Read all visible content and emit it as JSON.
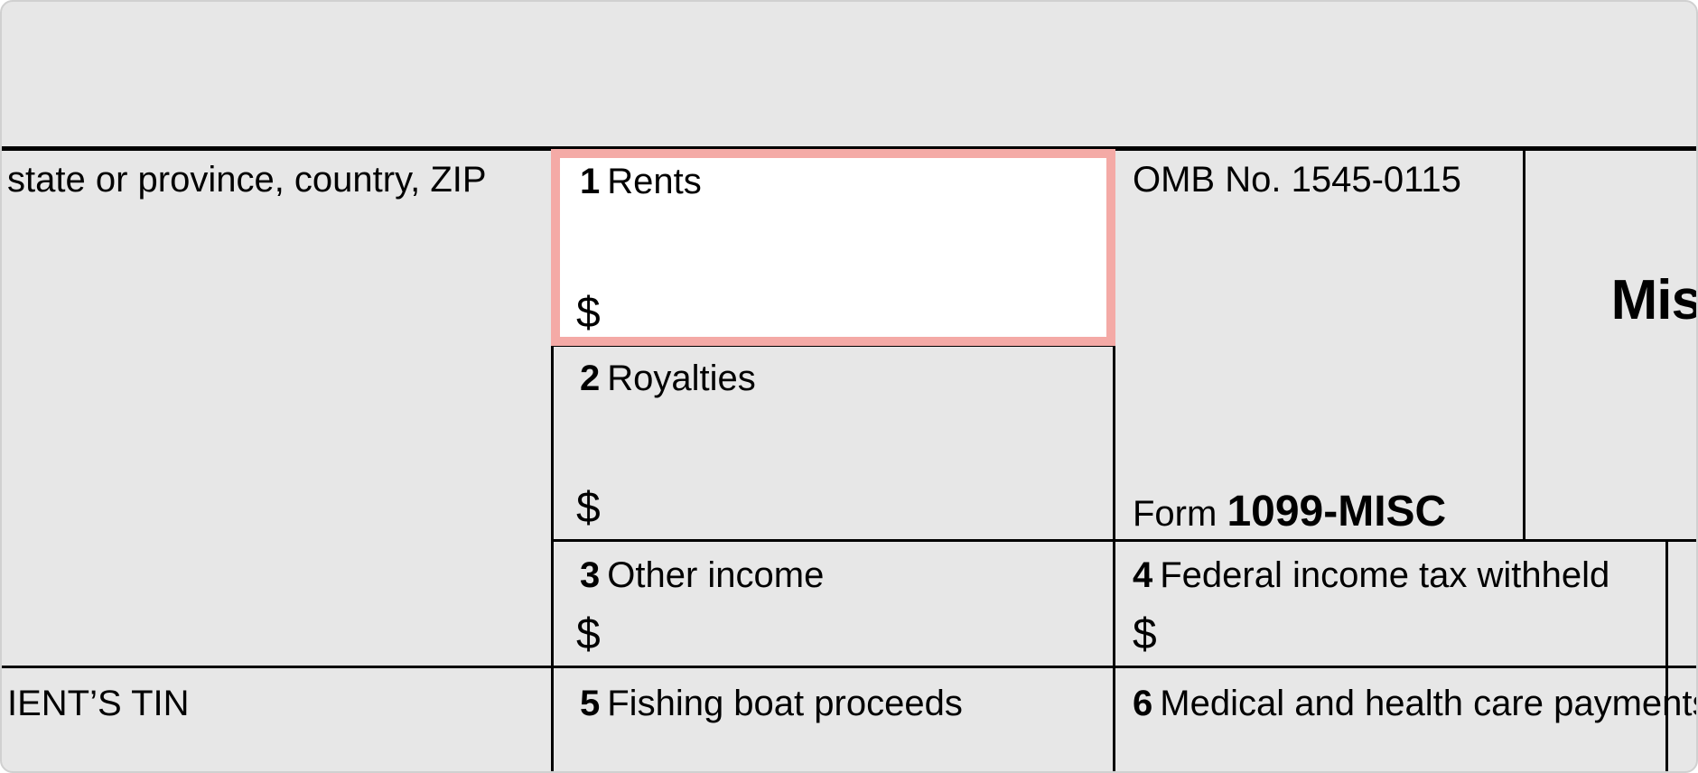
{
  "payer": {
    "address_line_fragment": "state or province, country, ZIP"
  },
  "recipient": {
    "tin_label_fragment": "IENT’S TIN"
  },
  "omb": {
    "label": "OMB No. 1545-0115"
  },
  "form_id": {
    "prefix": "Form ",
    "code": "1099-MISC"
  },
  "title_fragment": "Mis",
  "boxes": {
    "b1": {
      "num": "1",
      "label": "Rents",
      "currency": "$"
    },
    "b2": {
      "num": "2",
      "label": "Royalties",
      "currency": "$"
    },
    "b3": {
      "num": "3",
      "label": "Other income",
      "currency": "$"
    },
    "b4": {
      "num": "4",
      "label": "Federal income tax withheld",
      "currency": "$"
    },
    "b5": {
      "num": "5",
      "label": "Fishing boat proceeds"
    },
    "b6": {
      "num": "6",
      "label": "Medical and health care payments"
    }
  }
}
